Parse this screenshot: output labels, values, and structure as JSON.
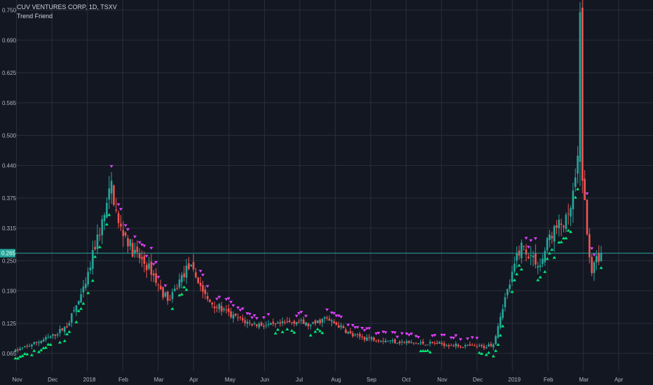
{
  "legend": {
    "symbol_line": "CUV VENTURES CORP, 1D, TSXV",
    "indicator_name": "Trend Friend"
  },
  "colors": {
    "background": "#131722",
    "grid": "#2a2e39",
    "up_candle": "#26a69a",
    "down_candle": "#ef5350",
    "buy_marker": "#00e676",
    "sell_marker": "#e040fb",
    "last_price_line": "#26a69a"
  },
  "icons": {
    "buy_marker": "triangle-up-icon",
    "sell_marker": "triangle-down-icon"
  },
  "chart_data": {
    "type": "candlestick",
    "title": "CUV VENTURES CORP, 1D, TSXV",
    "indicator": "Trend Friend",
    "y_ticks": [
      "0.750",
      "0.690",
      "0.625",
      "0.565",
      "0.500",
      "0.440",
      "0.375",
      "0.315",
      "0.250",
      "0.190",
      "0.125",
      "0.065"
    ],
    "ylim": [
      0.03,
      0.77
    ],
    "x_ticks": [
      "Nov",
      "Dec",
      "2018",
      "Feb",
      "Mar",
      "Apr",
      "May",
      "Jun",
      "Jul",
      "Aug",
      "Sep",
      "Oct",
      "Nov",
      "Dec",
      "2019",
      "Feb",
      "Mar",
      "Apr"
    ],
    "last_price": "0.265",
    "last_price_value": 0.265,
    "grid": true,
    "series_path": [
      [
        0,
        0.07
      ],
      [
        8,
        0.085
      ],
      [
        16,
        0.1
      ],
      [
        22,
        0.12
      ],
      [
        26,
        0.16
      ],
      [
        30,
        0.2
      ],
      [
        34,
        0.28
      ],
      [
        38,
        0.34
      ],
      [
        41,
        0.4
      ],
      [
        44,
        0.32
      ],
      [
        47,
        0.3
      ],
      [
        50,
        0.27
      ],
      [
        54,
        0.25
      ],
      [
        58,
        0.23
      ],
      [
        62,
        0.19
      ],
      [
        66,
        0.17
      ],
      [
        70,
        0.21
      ],
      [
        74,
        0.24
      ],
      [
        78,
        0.21
      ],
      [
        82,
        0.17
      ],
      [
        86,
        0.16
      ],
      [
        92,
        0.14
      ],
      [
        100,
        0.125
      ],
      [
        110,
        0.12
      ],
      [
        120,
        0.13
      ],
      [
        126,
        0.12
      ],
      [
        132,
        0.135
      ],
      [
        138,
        0.12
      ],
      [
        144,
        0.1
      ],
      [
        152,
        0.095
      ],
      [
        160,
        0.09
      ],
      [
        170,
        0.085
      ],
      [
        180,
        0.085
      ],
      [
        190,
        0.08
      ],
      [
        200,
        0.078
      ],
      [
        204,
        0.085
      ],
      [
        208,
        0.16
      ],
      [
        212,
        0.22
      ],
      [
        214,
        0.26
      ],
      [
        216,
        0.28
      ],
      [
        220,
        0.26
      ],
      [
        224,
        0.24
      ],
      [
        228,
        0.3
      ],
      [
        232,
        0.32
      ],
      [
        236,
        0.33
      ],
      [
        238,
        0.38
      ],
      [
        240,
        0.44
      ],
      [
        241,
        0.74
      ],
      [
        242,
        0.42
      ],
      [
        244,
        0.3
      ],
      [
        246,
        0.23
      ],
      [
        248,
        0.25
      ],
      [
        250,
        0.265
      ]
    ]
  }
}
